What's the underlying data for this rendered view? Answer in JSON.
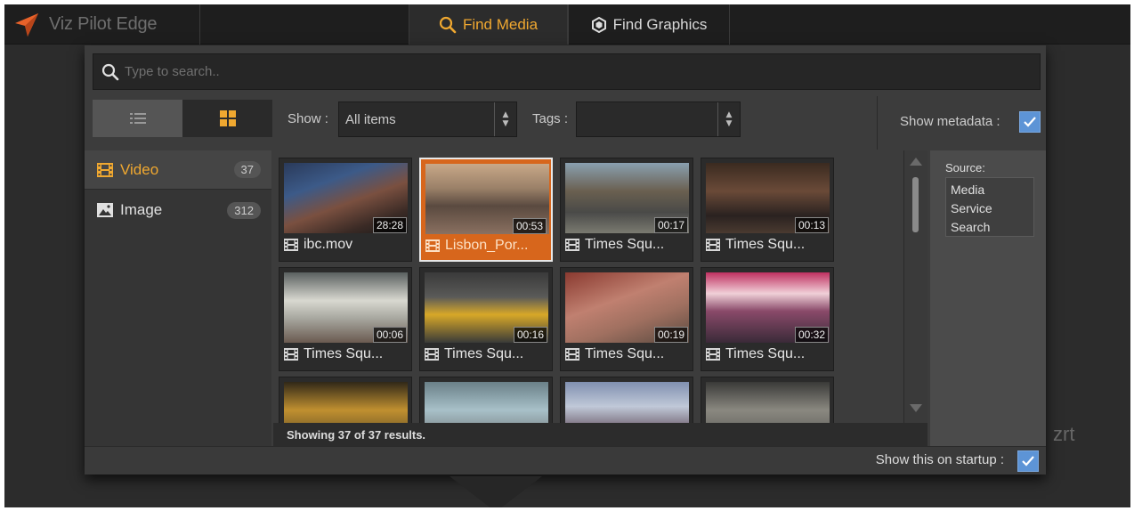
{
  "app": {
    "title": "Viz Pilot Edge",
    "brand_fragment": "zrt"
  },
  "tabs": [
    {
      "label": "Find Media",
      "active": true,
      "icon": "search-icon"
    },
    {
      "label": "Find Graphics",
      "active": false,
      "icon": "hexagon-icon"
    }
  ],
  "search": {
    "placeholder": "Type to search.."
  },
  "toolbar": {
    "show_label": "Show :",
    "show_value": "All items",
    "tags_label": "Tags :",
    "tags_value": "",
    "metadata_label": "Show metadata :",
    "metadata_checked": true,
    "active_view": "grid"
  },
  "categories": [
    {
      "label": "Video",
      "count": "37",
      "icon": "film-icon",
      "active": true
    },
    {
      "label": "Image",
      "count": "312",
      "icon": "image-icon",
      "active": false
    }
  ],
  "media": [
    {
      "name": "ibc.mov",
      "duration": "28:28"
    },
    {
      "name": "Lisbon_Por...",
      "duration": "00:53",
      "selected": true
    },
    {
      "name": "Times Squ...",
      "duration": "00:17"
    },
    {
      "name": "Times Squ...",
      "duration": "00:13"
    },
    {
      "name": "Times Squ...",
      "duration": "00:06"
    },
    {
      "name": "Times Squ...",
      "duration": "00:16"
    },
    {
      "name": "Times Squ...",
      "duration": "00:19"
    },
    {
      "name": "Times Squ...",
      "duration": "00:32"
    },
    {
      "name": "",
      "duration": ""
    },
    {
      "name": "",
      "duration": ""
    },
    {
      "name": "",
      "duration": ""
    },
    {
      "name": "",
      "duration": ""
    }
  ],
  "results": {
    "text": "Showing 37 of 37 results."
  },
  "metadata": {
    "source_label": "Source:",
    "source_value": "Media Service Search"
  },
  "footer": {
    "startup_label": "Show this on startup :",
    "startup_checked": true
  },
  "colors": {
    "accent": "#f0a830",
    "selection": "#d7661c",
    "checkbox": "#5d94d6"
  }
}
